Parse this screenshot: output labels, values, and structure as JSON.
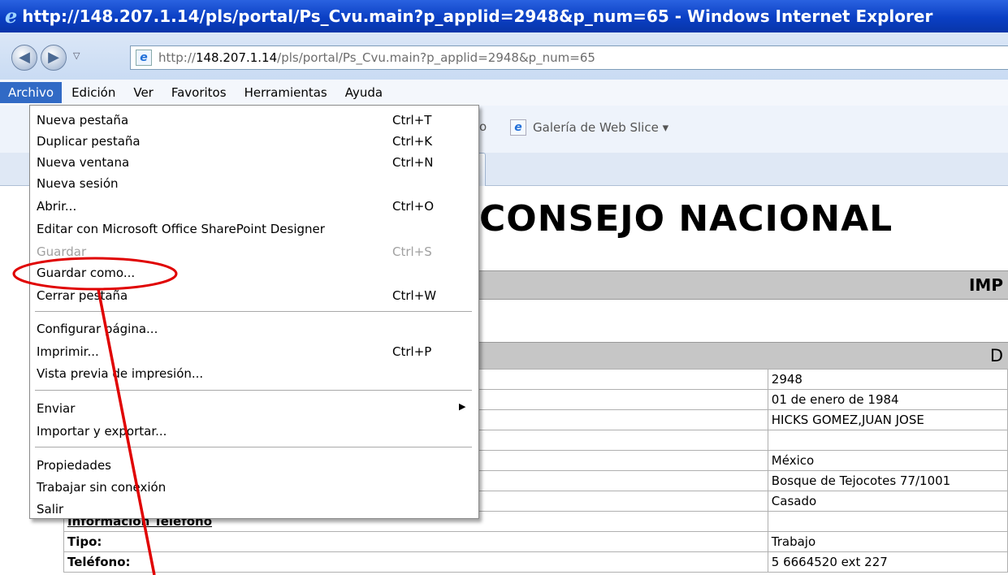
{
  "window": {
    "title": "http://148.207.1.14/pls/portal/Ps_Cvu.main?p_applid=2948&p_num=65 - Windows Internet Explorer",
    "icon": "ie-logo-icon"
  },
  "address_bar": {
    "url_prefix": "http://",
    "url_host": "148.207.1.14",
    "url_path": "/pls/portal/Ps_Cvu.main?p_applid=2948&p_num=65"
  },
  "menu_bar": {
    "items": [
      "Archivo",
      "Edición",
      "Ver",
      "Favoritos",
      "Herramientas",
      "Ayuda"
    ],
    "active_index": 0
  },
  "favorites_bar": {
    "partial_label": "ito",
    "web_slice_label": "Galería de Web Slice ▾"
  },
  "page": {
    "heading": "CONSEJO NACIONAL",
    "bar1_label": "IMP",
    "bar2_label": "D",
    "rows": [
      {
        "label": "",
        "value": "2948"
      },
      {
        "label": "",
        "value": "01 de enero de 1984"
      },
      {
        "label": "",
        "value": "HICKS GOMEZ,JUAN JOSE"
      },
      {
        "label": "",
        "value": ""
      },
      {
        "label": "",
        "value": "México"
      },
      {
        "label": "",
        "value": "Bosque de Tejocotes   77/1001"
      },
      {
        "label": "",
        "value": "Casado"
      },
      {
        "label": "Informacion Telefono",
        "value": ""
      },
      {
        "label": "Tipo:",
        "value": "Trabajo"
      },
      {
        "label": "Teléfono:",
        "value": "5 6664520 ext 227"
      }
    ]
  },
  "file_menu": {
    "items": [
      {
        "label": "Nueva pestaña",
        "shortcut": "Ctrl+T",
        "disabled": false
      },
      {
        "label": "Duplicar pestaña",
        "shortcut": "Ctrl+K",
        "disabled": false
      },
      {
        "label": "Nueva ventana",
        "shortcut": "Ctrl+N",
        "disabled": false
      },
      {
        "label": "Nueva sesión",
        "shortcut": "",
        "disabled": false
      },
      {
        "label": "Abrir...",
        "shortcut": "Ctrl+O",
        "disabled": false
      },
      {
        "label": "Editar con Microsoft Office SharePoint Designer",
        "shortcut": "",
        "disabled": false
      },
      {
        "label": "Guardar",
        "shortcut": "Ctrl+S",
        "disabled": true
      },
      {
        "label": "Guardar como...",
        "shortcut": "",
        "disabled": false
      },
      {
        "label": "Cerrar pestaña",
        "shortcut": "Ctrl+W",
        "disabled": false
      },
      {
        "label": "Configurar página...",
        "shortcut": "",
        "disabled": false
      },
      {
        "label": "Imprimir...",
        "shortcut": "Ctrl+P",
        "disabled": false
      },
      {
        "label": "Vista previa de impresión...",
        "shortcut": "",
        "disabled": false
      },
      {
        "label": "Enviar",
        "shortcut": "",
        "disabled": false,
        "submenu": true
      },
      {
        "label": "Importar y exportar...",
        "shortcut": "",
        "disabled": false
      },
      {
        "label": "Propiedades",
        "shortcut": "",
        "disabled": false
      },
      {
        "label": "Trabajar sin conexión",
        "shortcut": "",
        "disabled": false
      },
      {
        "label": "Salir",
        "shortcut": "",
        "disabled": false
      }
    ]
  },
  "annotation": {
    "highlighted_item": "Guardar como...",
    "color": "#e00000"
  }
}
